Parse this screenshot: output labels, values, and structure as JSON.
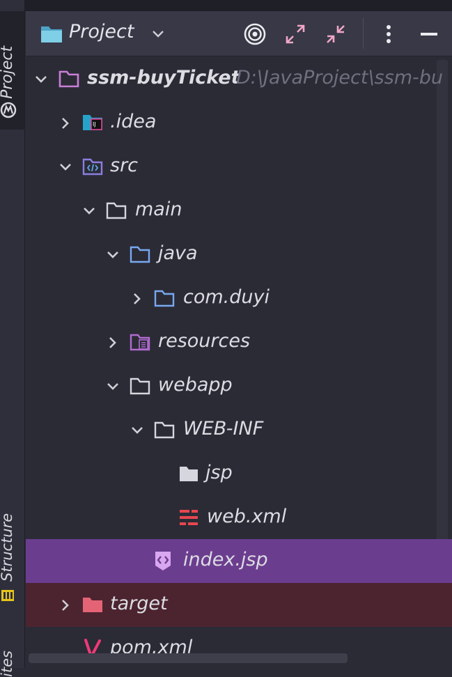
{
  "strip": {
    "project_label": "Project",
    "structure_label": "Structure",
    "favorites_label": "ites"
  },
  "header": {
    "title": "Project"
  },
  "tree": [
    {
      "label": "ssm-buyTicket",
      "path": "D:\\JavaProject\\ssm-bu",
      "depth": 0,
      "expanded": true,
      "icon": "module-folder-icon"
    },
    {
      "label": ".idea",
      "depth": 1,
      "expanded": false,
      "icon": "idea-folder-icon"
    },
    {
      "label": "src",
      "depth": 1,
      "expanded": true,
      "icon": "source-folder-icon"
    },
    {
      "label": "main",
      "depth": 2,
      "expanded": true,
      "icon": "folder-icon"
    },
    {
      "label": "java",
      "depth": 3,
      "expanded": true,
      "icon": "source-root-icon"
    },
    {
      "label": "com.duyi",
      "depth": 4,
      "expanded": false,
      "icon": "package-icon"
    },
    {
      "label": "resources",
      "depth": 3,
      "expanded": false,
      "icon": "resources-folder-icon"
    },
    {
      "label": "webapp",
      "depth": 3,
      "expanded": true,
      "icon": "folder-icon"
    },
    {
      "label": "WEB-INF",
      "depth": 4,
      "expanded": true,
      "icon": "folder-icon"
    },
    {
      "label": "jsp",
      "depth": 5,
      "icon": "folder-filled-icon"
    },
    {
      "label": "web.xml",
      "depth": 5,
      "icon": "xml-config-icon"
    },
    {
      "label": "index.jsp",
      "depth": 4,
      "icon": "jsp-file-icon",
      "selected": true
    },
    {
      "label": "target",
      "depth": 1,
      "expanded": false,
      "icon": "excluded-folder-icon",
      "excluded": true
    },
    {
      "label": "pom.xml",
      "depth": 1,
      "icon": "maven-icon"
    }
  ]
}
